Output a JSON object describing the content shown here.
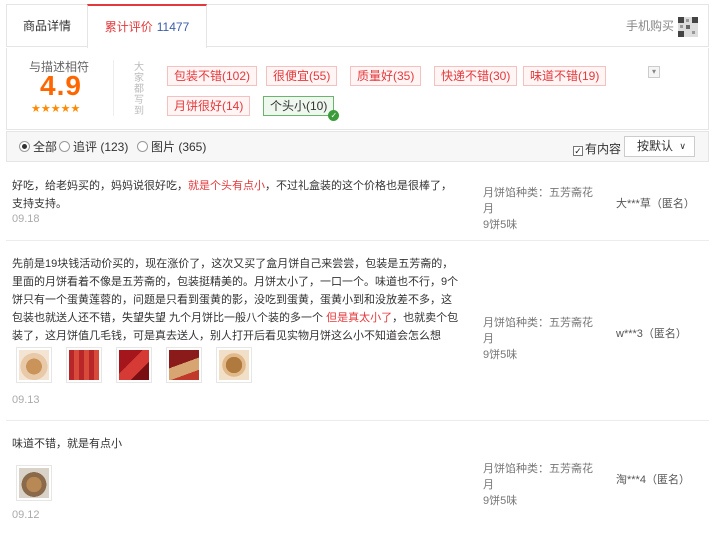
{
  "tabs": {
    "details": "商品详情",
    "reviews_label": "累计评价",
    "reviews_count": "11477",
    "mobile_buy": "手机购买"
  },
  "summary": {
    "score_label": "与描述相符",
    "score": "4.9",
    "stars": "★★★★★",
    "dajia_label": "大家都写到",
    "tags": [
      {
        "label": "包装不错(102)",
        "selected": false
      },
      {
        "label": "很便宜(55)",
        "selected": false
      },
      {
        "label": "质量好(35)",
        "selected": false
      },
      {
        "label": "快递不错(30)",
        "selected": false
      },
      {
        "label": "味道不错(19)",
        "selected": false
      },
      {
        "label": "月饼很好(14)",
        "selected": false
      },
      {
        "label": "个头小(10)",
        "selected": true
      }
    ]
  },
  "filter": {
    "options": [
      {
        "label": "全部",
        "selected": true
      },
      {
        "label": "追评 (123)",
        "selected": false
      },
      {
        "label": "图片 (365)",
        "selected": false
      }
    ],
    "has_content": "有内容",
    "has_content_checked": true,
    "sort": "按默认"
  },
  "reviews": [
    {
      "text_before": "好吃，给老妈买的，妈妈说很好吃，",
      "text_highlight": "就是个头有点小",
      "text_after": "，不过礼盒装的这个价格也是很棒了，支持支持。",
      "date": "09.18",
      "meta_line1": "月饼馅种类：五芳斋花月",
      "meta_line2": "9饼5味",
      "user": "大***草（匿名）"
    },
    {
      "text_before": "先前是19块钱活动价买的，现在涨价了，这次又买了盒月饼自己来尝尝，包装是五芳斋的，里面的月饼看着不像是五芳斋的，包装挺精美的。月饼太小了，一口一个。味道也不行，9个饼只有一个蛋黄莲蓉的，问题是只看到蛋黄的影，没吃到蛋黄，蛋黄小到和没放差不多，这包装也就送人还不错，失望失望 九个月饼比一般八个装的多一个 ",
      "text_highlight": "但是真太小了",
      "text_after": "，也就卖个包装了，这月饼值几毛钱，可是真去送人，别人打开后看见实物月饼这么小不知道会怎么想",
      "date": "09.13",
      "meta_line1": "月饼馅种类：五芳斋花月",
      "meta_line2": "9饼5味",
      "user": "w***3（匿名）"
    },
    {
      "text_before": "味道不错，就是有点小",
      "text_highlight": "",
      "text_after": "",
      "date": "09.12",
      "meta_line1": "月饼馅种类：五芳斋花月",
      "meta_line2": "9饼5味",
      "user": "淘***4（匿名）"
    }
  ],
  "colors": {
    "accent": "#e4393c",
    "score": "#ff6600",
    "link_blue": "#3c5ea8"
  }
}
